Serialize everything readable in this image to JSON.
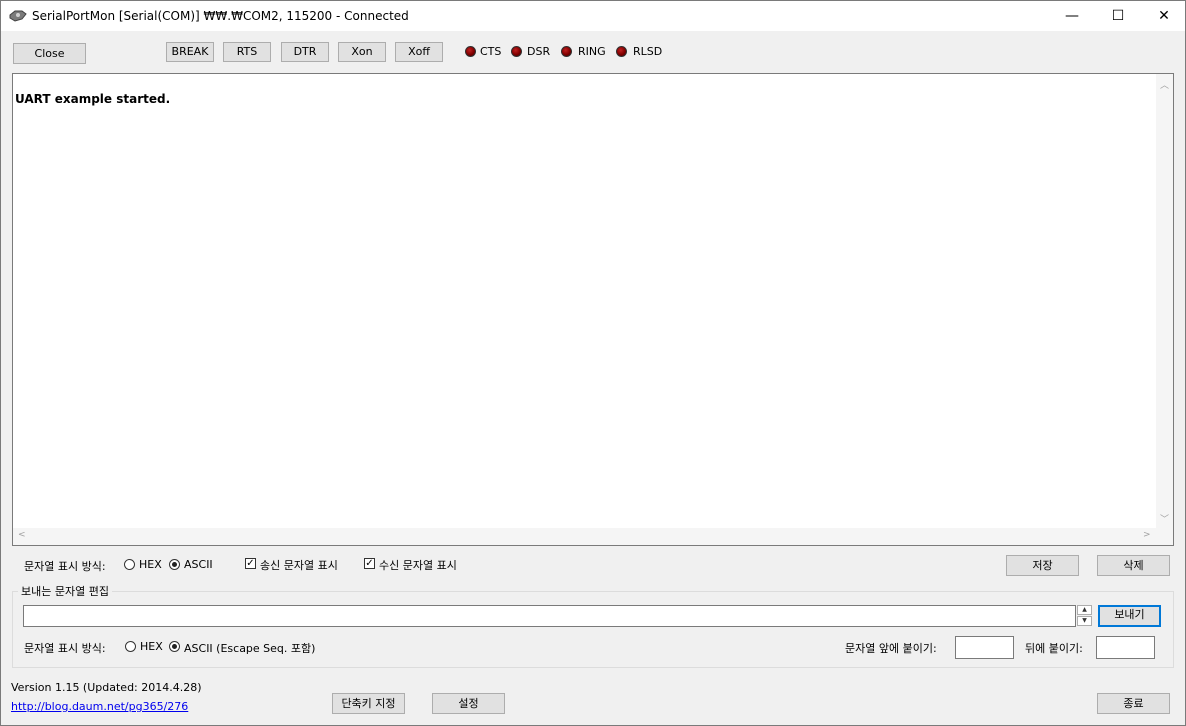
{
  "window": {
    "title": "SerialPortMon [Serial(COM)] ₩₩.₩COM2, 115200 - Connected",
    "minimize_glyph": "—",
    "maximize_glyph": "☐",
    "close_glyph": "✕"
  },
  "toolbar": {
    "close_label": "Close",
    "break_label": "BREAK",
    "rts_label": "RTS",
    "dtr_label": "DTR",
    "xon_label": "Xon",
    "xoff_label": "Xoff",
    "leds": [
      "CTS",
      "DSR",
      "RING",
      "RLSD"
    ],
    "led_color": "#8b0000"
  },
  "output": {
    "text": "UART example started."
  },
  "display": {
    "mode_label": "문자열 표시 방식:",
    "hex_label": "HEX",
    "ascii_label": "ASCII",
    "selected": "ASCII",
    "show_sent_label": "송신 문자열 표시",
    "show_sent_checked": true,
    "show_recv_label": "수신 문자열 표시",
    "show_recv_checked": true,
    "save_label": "저장",
    "delete_label": "삭제"
  },
  "send": {
    "group_title": "보내는 문자열 편집",
    "input_value": "",
    "send_label": "보내기",
    "mode_label": "문자열 표시 방식:",
    "hex_label": "HEX",
    "ascii_label": "ASCII (Escape Seq. 포함)",
    "selected": "ASCII",
    "prefix_label": "문자열 앞에 붙이기:",
    "prefix_value": "",
    "suffix_label": "뒤에 붙이기:",
    "suffix_value": ""
  },
  "footer": {
    "version": "Version 1.15 (Updated: 2014.4.28)",
    "link": "http://blog.daum.net/pg365/276",
    "shortcut_label": "단축키 지정",
    "settings_label": "설정",
    "exit_label": "종료"
  },
  "colors": {
    "accent": "#0078d7",
    "background": "#f0f0f0"
  }
}
